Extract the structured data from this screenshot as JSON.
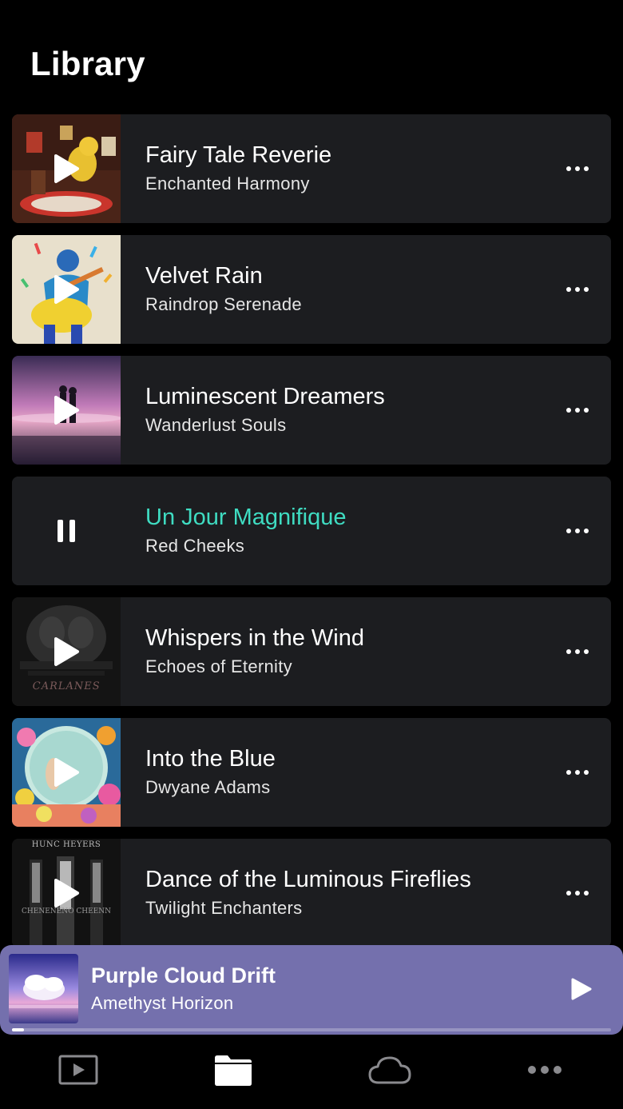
{
  "header": {
    "title": "Library"
  },
  "tracks": [
    {
      "title": "Fairy Tale Reverie",
      "artist": "Enchanted Harmony",
      "state": "play",
      "art": "fairy"
    },
    {
      "title": "Velvet Rain",
      "artist": "Raindrop Serenade",
      "state": "play",
      "art": "guitar"
    },
    {
      "title": "Luminescent Dreamers",
      "artist": "Wanderlust Souls",
      "state": "play",
      "art": "dreamers"
    },
    {
      "title": "Un Jour Magnifique",
      "artist": "Red Cheeks",
      "state": "pause",
      "art": "none"
    },
    {
      "title": "Whispers in the Wind",
      "artist": "Echoes of Eternity",
      "state": "play",
      "art": "dark",
      "art_text": "CARLANES"
    },
    {
      "title": "Into the Blue",
      "artist": "Dwyane Adams",
      "state": "play",
      "art": "globe"
    },
    {
      "title": "Dance of the Luminous Fireflies",
      "artist": "Twilight Enchanters",
      "state": "play",
      "art": "doors",
      "art_text_top": "HUNC HEYERS",
      "art_text_bottom": "CHENENENO CHEENN"
    }
  ],
  "now_playing": {
    "title": "Purple Cloud Drift",
    "artist": "Amethyst Horizon",
    "progress": 0.02,
    "accent_color": "#7470ad"
  },
  "colors": {
    "active_track": "#3fdcc2",
    "card_bg": "#1c1d20"
  },
  "tab_bar": [
    {
      "name": "player",
      "icon": "play-square-icon"
    },
    {
      "name": "library",
      "icon": "folder-icon",
      "active": true
    },
    {
      "name": "cloud",
      "icon": "cloud-icon"
    },
    {
      "name": "more",
      "icon": "more-horizontal-icon"
    }
  ]
}
